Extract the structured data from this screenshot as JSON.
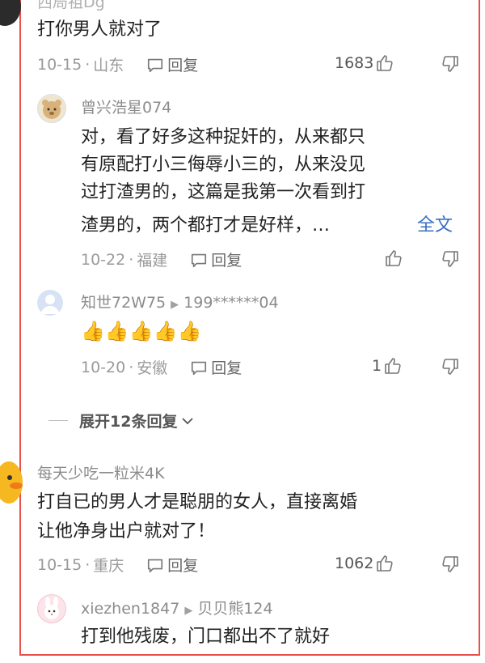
{
  "comments": [
    {
      "username": "西局祖Dg",
      "text": "打你男人就对了",
      "date": "10-15",
      "location": "山东",
      "reply_label": "回复",
      "likes": "1683"
    },
    {
      "username": "曾兴浩星074",
      "text_lines": [
        "对，看了好多这种捉奸的，从来都只",
        "有原配打小三侮辱小三的，从来没见",
        "过打渣男的，这篇是我第一次看到打",
        "渣男的，两个都打才是好样，…"
      ],
      "full_text_link": "全文",
      "date": "10-22",
      "location": "福建",
      "reply_label": "回复"
    },
    {
      "username": "知世72W75",
      "reply_to": "199******04",
      "emoji": "👍👍👍👍👍",
      "date": "10-20",
      "location": "安徽",
      "reply_label": "回复",
      "likes": "1"
    },
    {
      "username": "每天少吃一粒米4K",
      "text_lines": [
        "打自已的男人才是聪朋的女人，直接离婚",
        "让他净身出户就对了！"
      ],
      "date": "10-15",
      "location": "重庆",
      "reply_label": "回复",
      "likes": "1062"
    },
    {
      "username": "xiezhen1847",
      "reply_to": "贝贝熊124",
      "text": "打到他残废，门口都出不了就好"
    }
  ],
  "expand_replies": "展开12条回复",
  "dot": "·"
}
